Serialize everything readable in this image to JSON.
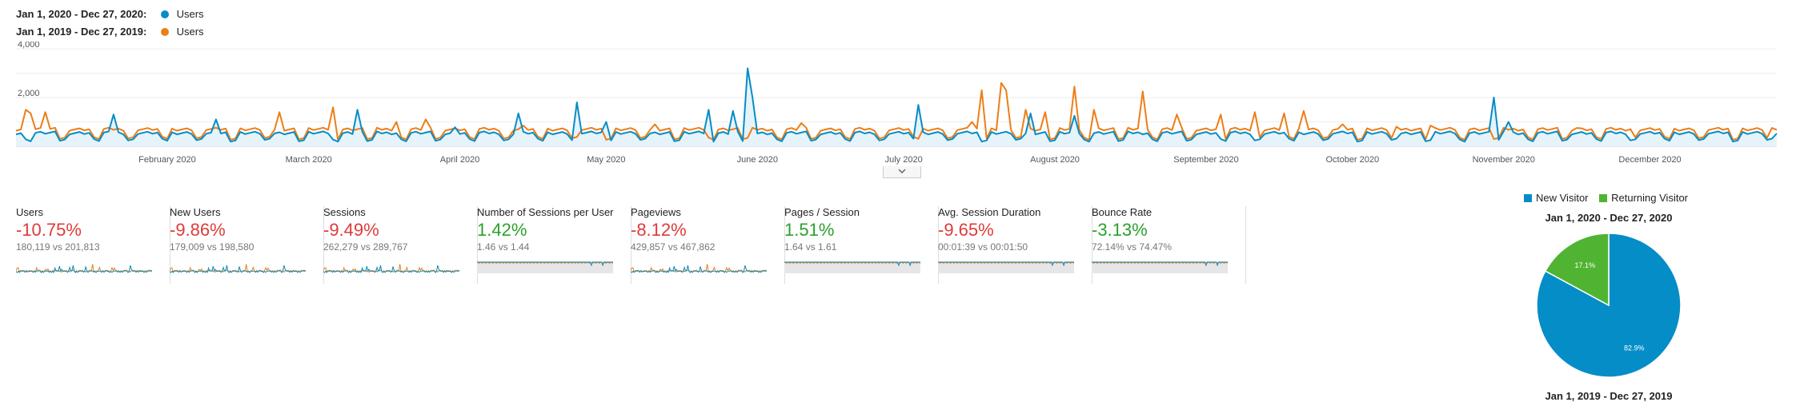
{
  "legend": {
    "current_range": "Jan 1, 2020 - Dec 27, 2020:",
    "previous_range": "Jan 1, 2019 - Dec 27, 2019:",
    "series_label": "Users"
  },
  "colors": {
    "current": "#058dc7",
    "previous": "#ed7e17",
    "negative": "#dd3b3b",
    "positive": "#2aa12a",
    "new_visitor": "#058dc7",
    "returning_visitor": "#50b432"
  },
  "chart_data": [
    {
      "type": "line",
      "xlabel": "",
      "ylabel": "",
      "ylim": [
        0,
        4000
      ],
      "yticks": [
        "4,000",
        "2,000"
      ],
      "x_tick_labels": [
        "February 2020",
        "March 2020",
        "April 2020",
        "May 2020",
        "June 2020",
        "July 2020",
        "August 2020",
        "September 2020",
        "October 2020",
        "November 2020",
        "December 2020"
      ],
      "x_tick_positions_day": [
        31,
        60,
        91,
        121,
        152,
        182,
        213,
        244,
        274,
        305,
        335
      ],
      "days": 362,
      "series": [
        {
          "name": "Users",
          "period": "Jan 1, 2020 - Dec 27, 2020",
          "baseline_weekday": 550,
          "baseline_weekend": 250,
          "spikes": [
            [
              20,
              1300
            ],
            [
              41,
              1100
            ],
            [
              70,
              1500
            ],
            [
              90,
              780
            ],
            [
              103,
              1350
            ],
            [
              115,
              1800
            ],
            [
              121,
              1000
            ],
            [
              142,
              1500
            ],
            [
              147,
              1450
            ],
            [
              150,
              3200
            ],
            [
              151,
              2000
            ],
            [
              185,
              1700
            ],
            [
              208,
              1350
            ],
            [
              217,
              1250
            ],
            [
              303,
              2000
            ],
            [
              306,
              1000
            ]
          ]
        },
        {
          "name": "Users",
          "period": "Jan 1, 2019 - Dec 27, 2019",
          "baseline_weekday": 700,
          "baseline_weekend": 330,
          "spikes": [
            [
              2,
              1500
            ],
            [
              3,
              1350
            ],
            [
              6,
              1400
            ],
            [
              54,
              1400
            ],
            [
              65,
              1600
            ],
            [
              78,
              1000
            ],
            [
              84,
              1100
            ],
            [
              104,
              850
            ],
            [
              131,
              900
            ],
            [
              161,
              950
            ],
            [
              196,
              1000
            ],
            [
              198,
              2300
            ],
            [
              202,
              2600
            ],
            [
              203,
              2300
            ],
            [
              207,
              1500
            ],
            [
              211,
              1400
            ],
            [
              217,
              2450
            ],
            [
              221,
              1500
            ],
            [
              231,
              2250
            ],
            [
              238,
              1300
            ],
            [
              247,
              1300
            ],
            [
              254,
              1400
            ],
            [
              260,
              1350
            ],
            [
              264,
              1450
            ],
            [
              272,
              900
            ],
            [
              283,
              800
            ],
            [
              290,
              850
            ],
            [
              320,
              750
            ],
            [
              331,
              700
            ],
            [
              360,
              750
            ]
          ]
        }
      ]
    },
    {
      "type": "pie",
      "title": "Jan 1, 2020 - Dec 27, 2020",
      "slices": [
        {
          "name": "New Visitor",
          "value": 82.9,
          "label": "82.9%"
        },
        {
          "name": "Returning Visitor",
          "value": 17.1,
          "label": "17.1%"
        }
      ]
    }
  ],
  "metrics": [
    {
      "name": "Users",
      "pct": "-10.75%",
      "dir": "neg",
      "compare": "180,119 vs 201,813",
      "spark": "volume"
    },
    {
      "name": "New Users",
      "pct": "-9.86%",
      "dir": "neg",
      "compare": "179,009 vs 198,580",
      "spark": "volume"
    },
    {
      "name": "Sessions",
      "pct": "-9.49%",
      "dir": "neg",
      "compare": "262,279 vs 289,767",
      "spark": "volume"
    },
    {
      "name": "Number of Sessions per User",
      "pct": "1.42%",
      "dir": "pos",
      "compare": "1.46 vs 1.44",
      "spark": "flat"
    },
    {
      "name": "Pageviews",
      "pct": "-8.12%",
      "dir": "neg",
      "compare": "429,857 vs 467,862",
      "spark": "volume"
    },
    {
      "name": "Pages / Session",
      "pct": "1.51%",
      "dir": "pos",
      "compare": "1.64 vs 1.61",
      "spark": "flat"
    },
    {
      "name": "Avg. Session Duration",
      "pct": "-9.65%",
      "dir": "neg",
      "compare": "00:01:39 vs 00:01:50",
      "spark": "flat"
    },
    {
      "name": "Bounce Rate",
      "pct": "-3.13%",
      "dir": "neg",
      "pct_color": "positive",
      "compare": "72.14% vs 74.47%",
      "spark": "flat"
    }
  ],
  "pie_legend": {
    "new_visitor": "New Visitor",
    "returning_visitor": "Returning Visitor"
  },
  "pie_titles": {
    "top": "Jan 1, 2020 - Dec 27, 2020",
    "bottom": "Jan 1, 2019 - Dec 27, 2019"
  }
}
